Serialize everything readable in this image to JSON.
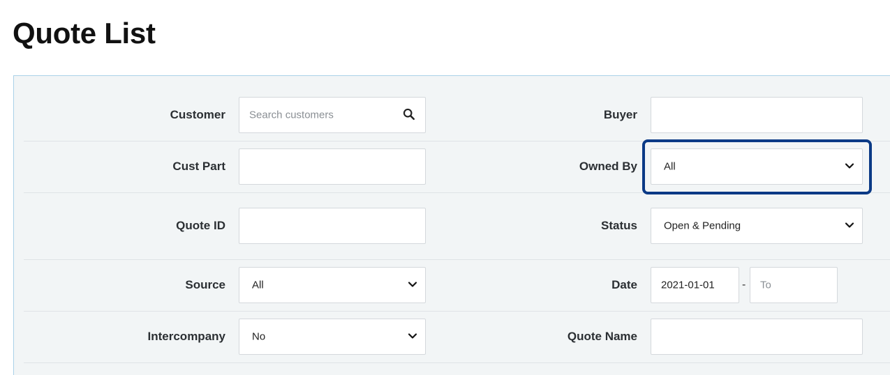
{
  "page": {
    "title": "Quote List"
  },
  "filters": {
    "customer": {
      "label": "Customer",
      "placeholder": "Search customers",
      "icon": "search-icon"
    },
    "buyer": {
      "label": "Buyer",
      "value": ""
    },
    "cust_part": {
      "label": "Cust Part",
      "value": ""
    },
    "owned_by": {
      "label": "Owned By",
      "selected": "All"
    },
    "quote_id": {
      "label": "Quote ID",
      "value": ""
    },
    "status": {
      "label": "Status",
      "selected": "Open & Pending"
    },
    "source": {
      "label": "Source",
      "selected": "All"
    },
    "date": {
      "label": "Date",
      "from": "2021-01-01",
      "separator": "-",
      "to_placeholder": "To"
    },
    "intercompany": {
      "label": "Intercompany",
      "selected": "No"
    },
    "quote_name": {
      "label": "Quote Name",
      "value": ""
    }
  },
  "colors": {
    "panel_bg": "#f2f5f6",
    "panel_border": "#a9d1e8",
    "focus_highlight": "#0b3a86"
  }
}
